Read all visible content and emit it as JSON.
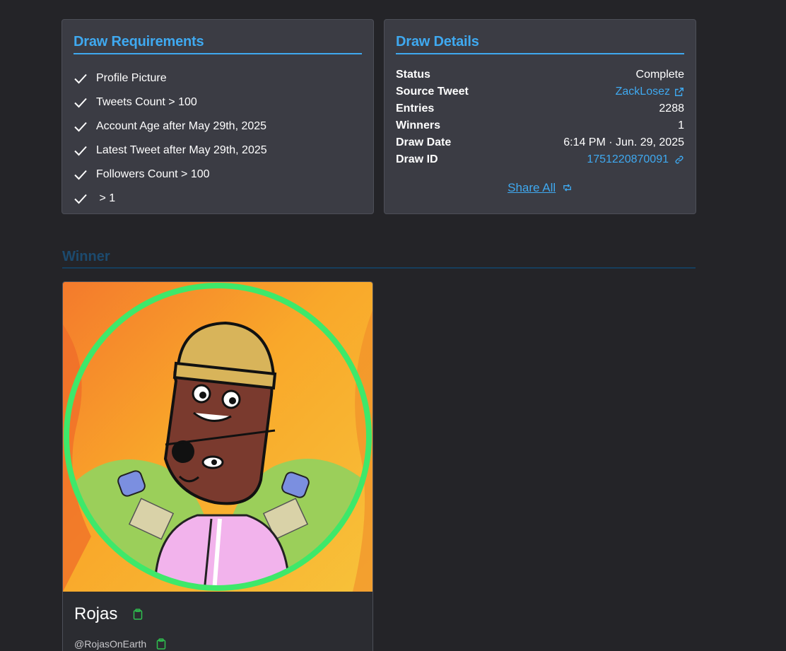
{
  "requirements": {
    "title": "Draw Requirements",
    "items": [
      {
        "label": "Profile Picture"
      },
      {
        "label": "Tweets Count > 100"
      },
      {
        "label": "Account Age after May 29th, 2025"
      },
      {
        "label": "Latest Tweet after May 29th, 2025"
      },
      {
        "label": "Followers Count > 100"
      },
      {
        "label": " > 1"
      }
    ]
  },
  "details": {
    "title": "Draw Details",
    "rows": [
      {
        "label": "Status",
        "value": "Complete"
      },
      {
        "label": "Source Tweet",
        "value": "ZackLosez"
      },
      {
        "label": "Entries",
        "value": "2288"
      },
      {
        "label": "Winners",
        "value": "1"
      },
      {
        "label": "Draw Date",
        "value": "6:14 PM · Jun. 29, 2025"
      },
      {
        "label": "Draw ID",
        "value": "1751220870091"
      }
    ],
    "share_label": "Share All"
  },
  "winner": {
    "heading": "Winner",
    "name": "Rojas",
    "handle": "@RojasOnEarth",
    "avatar_icon": "profile-avatar"
  },
  "colors": {
    "accent": "#3fa9f0",
    "background": "#242428",
    "card": "#3b3c44",
    "ring": "#3ee86a",
    "copy_icon": "#2fbf4f"
  }
}
